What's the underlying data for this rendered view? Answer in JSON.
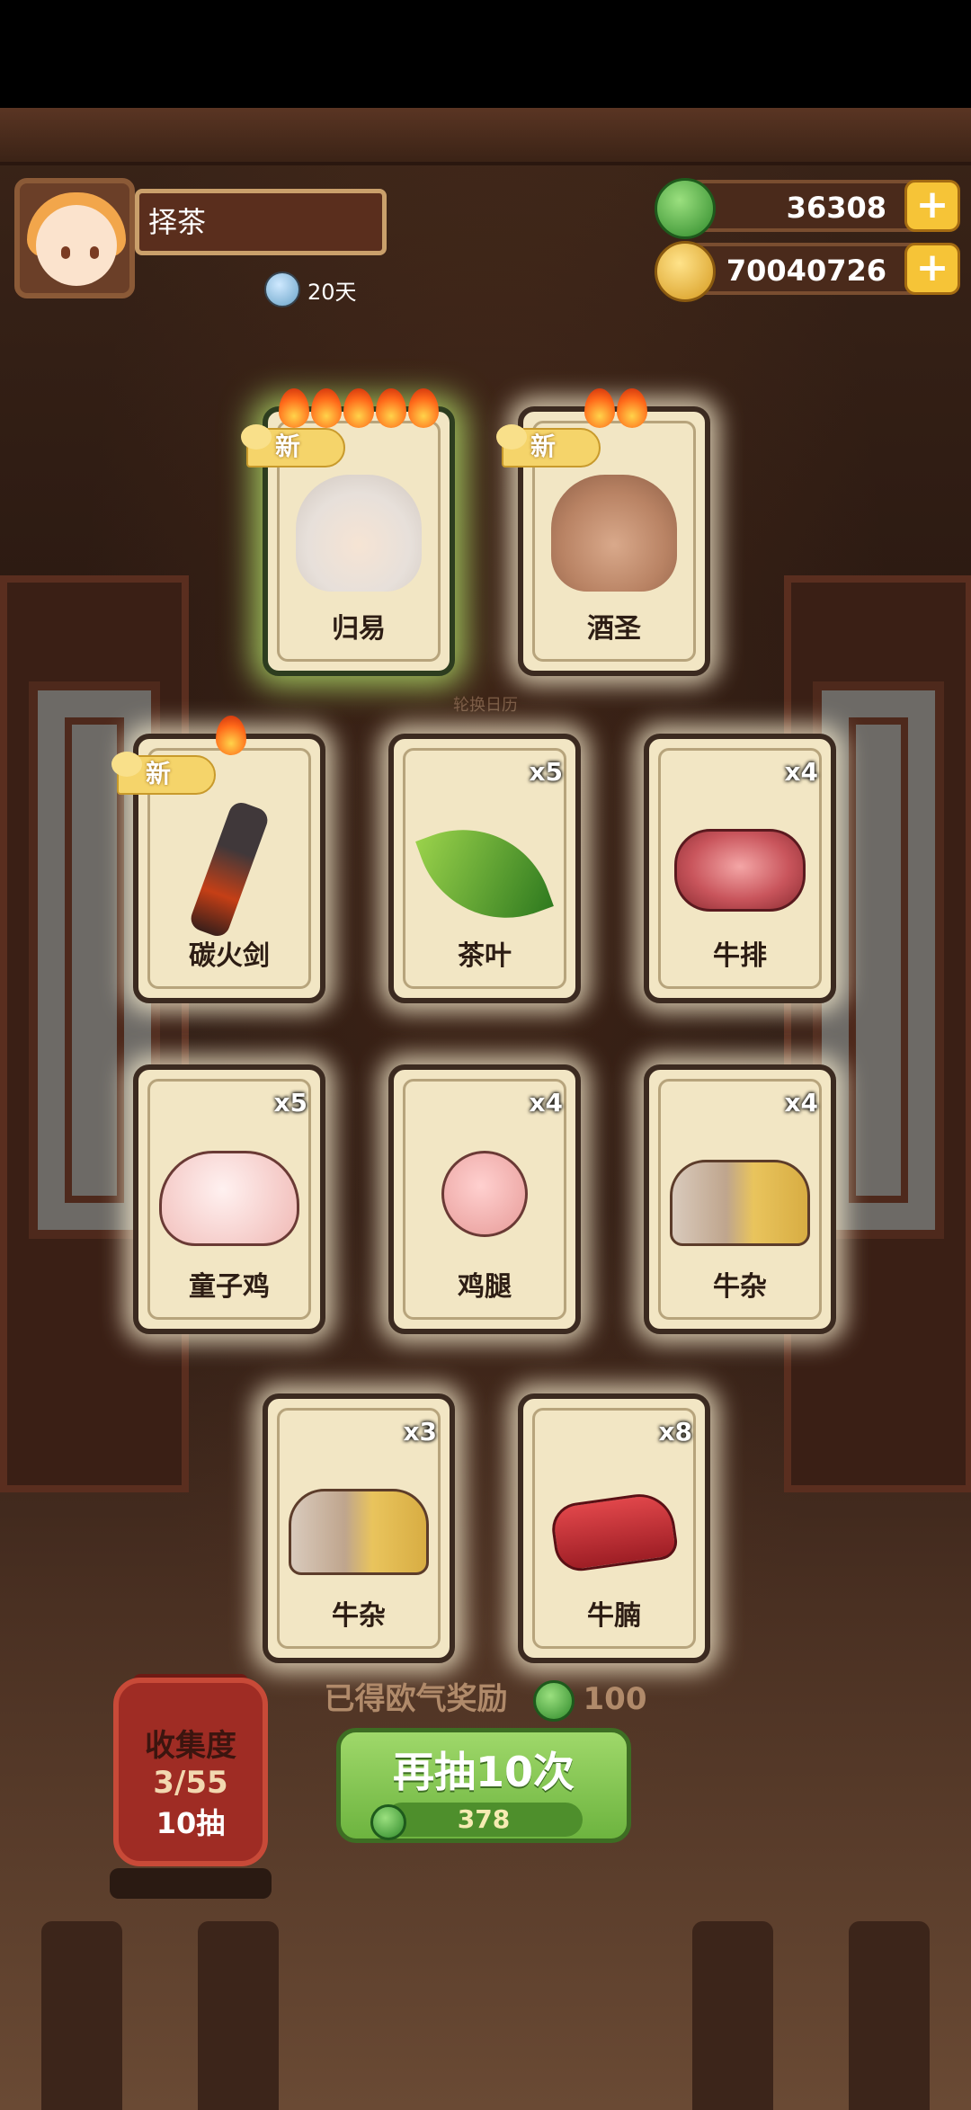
{
  "player": {
    "name": "择茶",
    "days": "20天"
  },
  "currency": {
    "jade": "36308",
    "gold": "70040726"
  },
  "cards_top": [
    {
      "label": "归易",
      "is_new": true,
      "new_text": "新",
      "flames": 5
    },
    {
      "label": "酒圣",
      "is_new": true,
      "new_text": "新",
      "flames": 2
    }
  ],
  "watermark": "轮换日历",
  "cards": [
    {
      "label": "碳火剑",
      "qty": "",
      "is_new": true,
      "new_text": "新",
      "flames": 1,
      "art": "knife"
    },
    {
      "label": "茶叶",
      "qty": "x5",
      "art": "leaf"
    },
    {
      "label": "牛排",
      "qty": "x4",
      "art": "steak"
    },
    {
      "label": "童子鸡",
      "qty": "x5",
      "art": "chicken"
    },
    {
      "label": "鸡腿",
      "qty": "x4",
      "art": "leg"
    },
    {
      "label": "牛杂",
      "qty": "x4",
      "art": "offal"
    },
    {
      "label": "牛杂",
      "qty": "x3",
      "art": "offal"
    },
    {
      "label": "牛腩",
      "qty": "x8",
      "art": "brisket"
    }
  ],
  "reward": {
    "text": "已得欧气奖励",
    "value": "100"
  },
  "collection": {
    "title": "收集度",
    "count": "3/55",
    "draws": "10抽"
  },
  "draw_button": {
    "label": "再抽10次",
    "cost": "378"
  },
  "colors": {
    "jade": "#2f8a2a",
    "gold": "#d69a1f",
    "button_green": "#7fc44c",
    "lantern_red": "#9f2c24"
  }
}
